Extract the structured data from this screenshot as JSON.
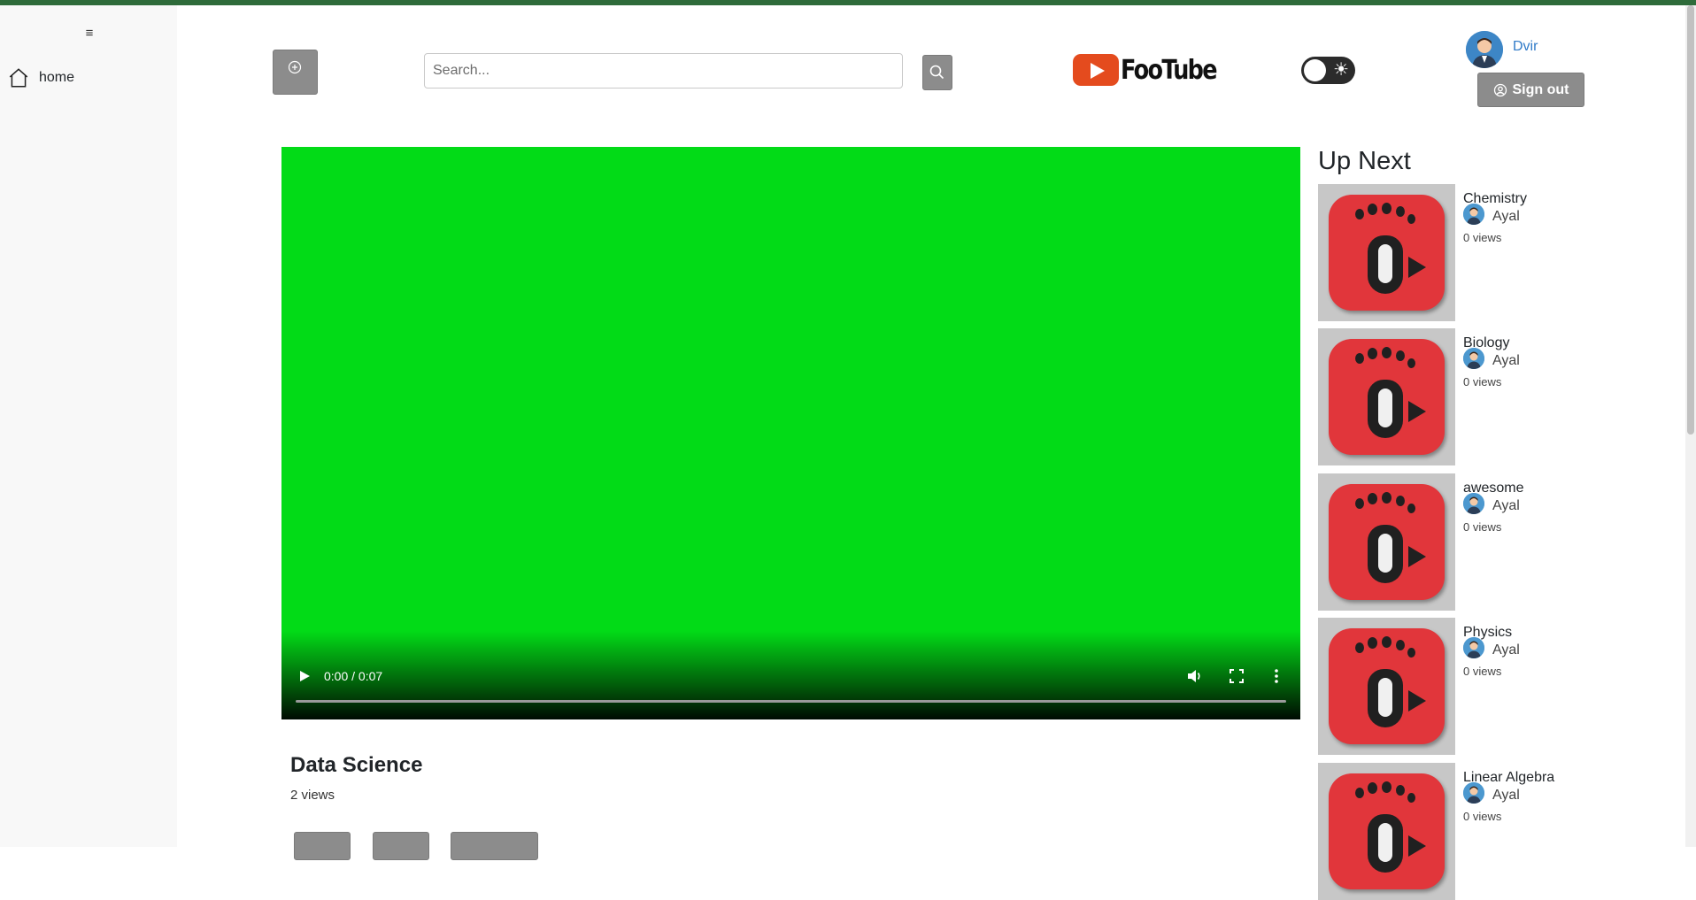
{
  "sidebar": {
    "menu_icon": "≡",
    "items": [
      {
        "label": "home",
        "icon": "home-icon"
      }
    ]
  },
  "header": {
    "search": {
      "placeholder": "Search...",
      "value": ""
    },
    "logo_text": "FooTube",
    "theme_toggle_icon": "☀",
    "user": {
      "name": "Dvir"
    },
    "signout_label": "Sign out"
  },
  "video": {
    "time": "0:00 / 0:07",
    "progress": 0,
    "title": "Data Science",
    "views": "2 views",
    "background_color": "#02db17"
  },
  "up_next": {
    "heading": "Up Next",
    "items": [
      {
        "title": "Chemistry",
        "author": "Ayal",
        "views": "0 views"
      },
      {
        "title": "Biology",
        "author": "Ayal",
        "views": "0 views"
      },
      {
        "title": "awesome",
        "author": "Ayal",
        "views": "0 views"
      },
      {
        "title": "Physics",
        "author": "Ayal",
        "views": "0 views"
      },
      {
        "title": "Linear Algebra",
        "author": "Ayal",
        "views": "0 views"
      }
    ]
  },
  "colors": {
    "accent_top_line": "#2e6b3a",
    "button_gray": "#8c8c8c",
    "link_blue": "#2f7ac8"
  }
}
